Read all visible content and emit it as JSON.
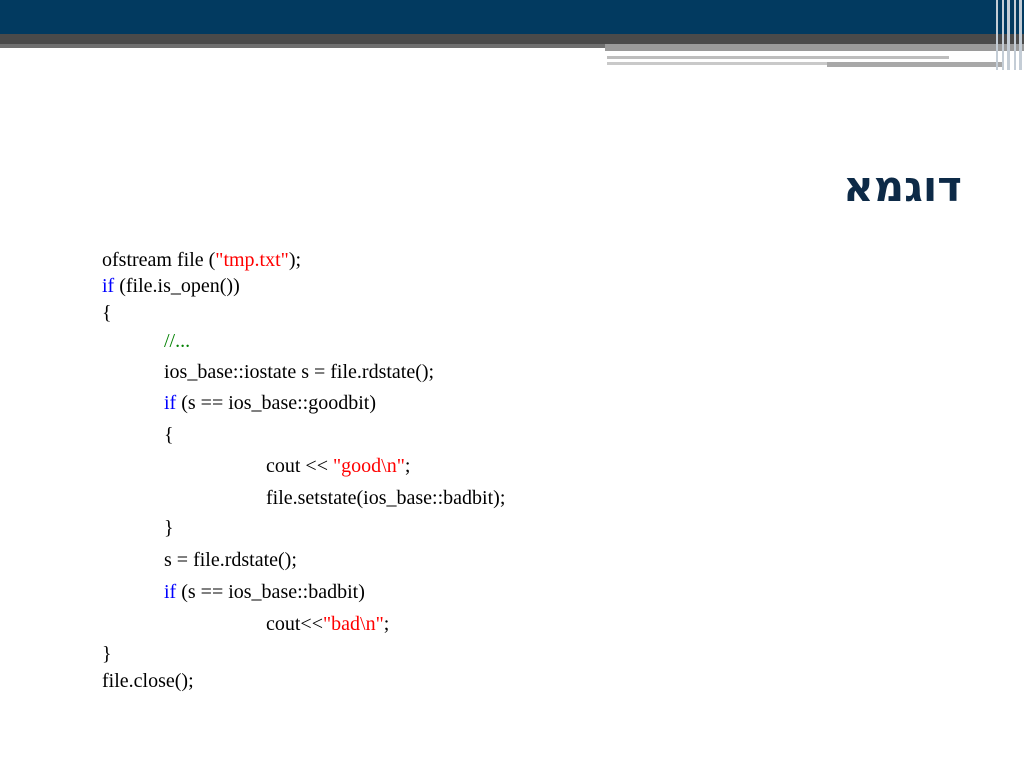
{
  "slide": {
    "title": "דוגמא"
  },
  "code": {
    "l1_a": "ofstream file (",
    "l1_str": "\"tmp.txt\"",
    "l1_b": ");",
    "l2_kw": "if",
    "l2_b": " (file.is_open())",
    "l3": "{",
    "l4_cmt": "//...",
    "l5": "ios_base::iostate s = file.rdstate();",
    "l6_kw": "if",
    "l6_b": " (s == ios_base::goodbit)",
    "l7": "{",
    "l8_a": "cout << ",
    "l8_str": "\"good\\n\"",
    "l8_b": ";",
    "l9": "file.setstate(ios_base::badbit);",
    "l10": "}",
    "l11": "s = file.rdstate();",
    "l12_kw": "if",
    "l12_b": " (s == ios_base::badbit)",
    "l13_a": "cout<<",
    "l13_str": "\"bad\\n\"",
    "l13_b": ";",
    "l14": "}",
    "l15": "file.close();"
  },
  "colors": {
    "header_band": "#023a60",
    "title": "#0d2a47",
    "keyword": "#0000ff",
    "string": "#ff0000",
    "comment": "#008000"
  }
}
